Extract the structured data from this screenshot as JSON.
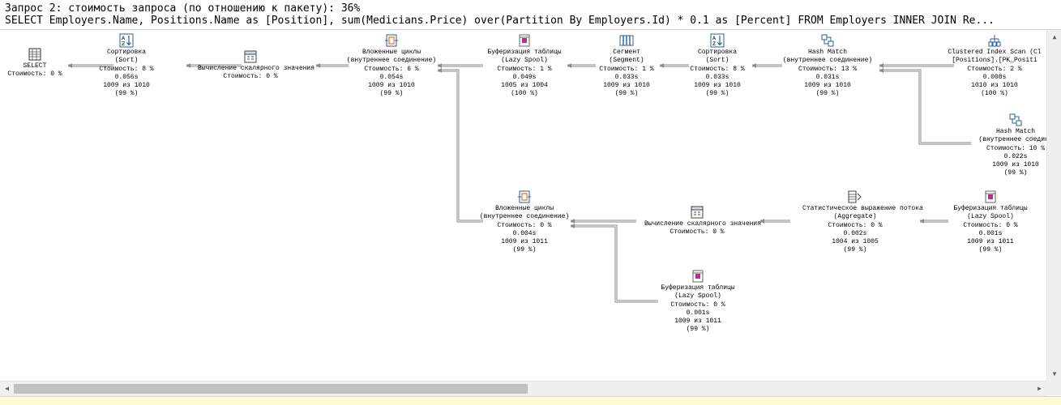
{
  "header": {
    "query_line": "Запрос 2: стоимость запроса (по отношению к пакету): 36%",
    "sql_line": "SELECT Employers.Name, Positions.Name as [Position], sum(Medicians.Price) over(Partition By Employers.Id) * 0.1 as [Percent] FROM Employers INNER JOIN Re..."
  },
  "plan": {
    "nodes": [
      {
        "id": "n-select",
        "icon": "select-icon",
        "lines": [
          "SELECT",
          "Стоимость: 0 %"
        ]
      },
      {
        "id": "n-sort1",
        "icon": "sort-icon",
        "lines": [
          "Сортировка",
          "(Sort)",
          "Стоимость: 8 %",
          "0.056s",
          "1009 из 1010",
          "(99 %)"
        ]
      },
      {
        "id": "n-scalar1",
        "icon": "compute-scalar-icon",
        "lines": [
          "Вычисление скалярного значения",
          "Стоимость: 0 %"
        ]
      },
      {
        "id": "n-nested1",
        "icon": "nested-loops-icon",
        "lines": [
          "Вложенные циклы",
          "(внутреннее соединение)",
          "Стоимость: 6 %",
          "0.054s",
          "1009 из 1010",
          "(99 %)"
        ]
      },
      {
        "id": "n-spool1",
        "icon": "table-spool-icon",
        "lines": [
          "Буферизация таблицы",
          "(Lazy Spool)",
          "Стоимость: 1 %",
          "0.049s",
          "1005 из 1004",
          "(100 %)"
        ]
      },
      {
        "id": "n-segment",
        "icon": "segment-icon",
        "lines": [
          "Сегмент",
          "(Segment)",
          "Стоимость: 1 %",
          "0.033s",
          "1009 из 1010",
          "(99 %)"
        ]
      },
      {
        "id": "n-sort2",
        "icon": "sort-icon",
        "lines": [
          "Сортировка",
          "(Sort)",
          "Стоимость: 8 %",
          "0.033s",
          "1009 из 1010",
          "(99 %)"
        ]
      },
      {
        "id": "n-hash1",
        "icon": "hash-match-icon",
        "lines": [
          "Hash Match",
          "(внутреннее соединение)",
          "Стоимость: 13 %",
          "0.031s",
          "1009 из 1010",
          "(99 %)"
        ]
      },
      {
        "id": "n-cis",
        "icon": "clustered-index-scan-icon",
        "lines": [
          "Clustered Index Scan (Cl",
          "[Positions].[PK_Positi",
          "Стоимость: 2 %",
          "0.008s",
          "1010 из 1010",
          "(100 %)"
        ]
      },
      {
        "id": "n-hash2",
        "icon": "hash-match-icon",
        "lines": [
          "Hash Match",
          "(внутреннее соедине",
          "Стоимость: 10 %",
          "0.022s",
          "1009 из 1010",
          "(99 %)"
        ]
      },
      {
        "id": "n-nested2",
        "icon": "nested-loops-icon",
        "lines": [
          "Вложенные циклы",
          "(внутреннее соединение)",
          "Стоимость: 0 %",
          "0.004s",
          "1009 из 1011",
          "(99 %)"
        ]
      },
      {
        "id": "n-scalar2",
        "icon": "compute-scalar-icon",
        "lines": [
          "Вычисление скалярного значения",
          "Стоимость: 0 %"
        ]
      },
      {
        "id": "n-aggregate",
        "icon": "stream-aggregate-icon",
        "lines": [
          "Статистическое выражение потока",
          "(Aggregate)",
          "Стоимость: 0 %",
          "0.002s",
          "1004 из 1005",
          "(99 %)"
        ]
      },
      {
        "id": "n-spool2",
        "icon": "table-spool-icon",
        "lines": [
          "Буферизация таблицы",
          "(Lazy Spool)",
          "Стоимость: 0 %",
          "0.001s",
          "1009 из 1011",
          "(99 %)"
        ]
      },
      {
        "id": "n-spool3",
        "icon": "table-spool-icon",
        "lines": [
          "Буферизация таблицы",
          "(Lazy Spool)",
          "Стоимость: 0 %",
          "0.001s",
          "1009 из 1011",
          "(99 %)"
        ]
      }
    ]
  }
}
